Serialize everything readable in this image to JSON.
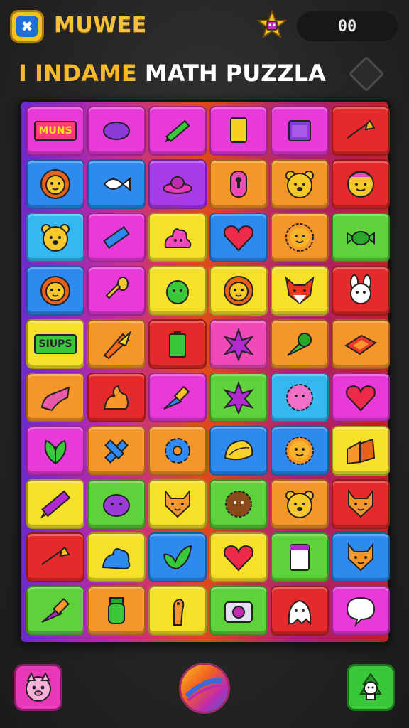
{
  "header": {
    "app_title": "MUWEE",
    "logo_glyph": "✖",
    "score": "00"
  },
  "title": {
    "part1": "I INDAME",
    "part2": "MATH PUZZLA"
  },
  "colors": {
    "purple": "#a93ce8",
    "magenta": "#e83ad8",
    "pink": "#f04ab8",
    "red": "#e42a2a",
    "orange": "#f5962a",
    "yellow": "#f7e02a",
    "green": "#5ed23a",
    "blue": "#2f8af0",
    "cyan": "#35b8f0"
  },
  "board": {
    "rows": [
      [
        {
          "color": "magenta",
          "icon": "text-label-icon",
          "label": "MUNS"
        },
        {
          "color": "magenta",
          "icon": "purple-bean-icon"
        },
        {
          "color": "magenta",
          "icon": "pencil-icon"
        },
        {
          "color": "magenta",
          "icon": "yellow-card-icon"
        },
        {
          "color": "magenta",
          "icon": "box-icon"
        },
        {
          "color": "red",
          "icon": "arrow-icon"
        }
      ],
      [
        {
          "color": "blue",
          "icon": "lion-face-icon"
        },
        {
          "color": "blue",
          "icon": "fish-icon"
        },
        {
          "color": "purple",
          "icon": "saucer-icon"
        },
        {
          "color": "orange",
          "icon": "keyhole-icon"
        },
        {
          "color": "orange",
          "icon": "bear-face-icon"
        },
        {
          "color": "red",
          "icon": "monkey-face-icon"
        }
      ],
      [
        {
          "color": "cyan",
          "icon": "bear-face-icon"
        },
        {
          "color": "magenta",
          "icon": "marker-icon"
        },
        {
          "color": "yellow",
          "icon": "blob-icon"
        },
        {
          "color": "blue",
          "icon": "heart-icon"
        },
        {
          "color": "orange",
          "icon": "sun-face-icon"
        },
        {
          "color": "green",
          "icon": "candy-icon"
        }
      ],
      [
        {
          "color": "blue",
          "icon": "lion-face-icon"
        },
        {
          "color": "magenta",
          "icon": "spoon-icon"
        },
        {
          "color": "yellow",
          "icon": "green-blob-icon"
        },
        {
          "color": "yellow",
          "icon": "lion-face-icon"
        },
        {
          "color": "yellow",
          "icon": "fox-face-icon"
        },
        {
          "color": "red",
          "icon": "bunny-face-icon"
        }
      ],
      [
        {
          "color": "yellow",
          "icon": "text-label-icon",
          "label": "SIUPS"
        },
        {
          "color": "orange",
          "icon": "rocket-icon"
        },
        {
          "color": "red",
          "icon": "battery-icon"
        },
        {
          "color": "pink",
          "icon": "star-burst-icon"
        },
        {
          "color": "orange",
          "icon": "pin-icon"
        },
        {
          "color": "orange",
          "icon": "diamond-icon"
        }
      ],
      [
        {
          "color": "orange",
          "icon": "boot-icon"
        },
        {
          "color": "red",
          "icon": "swirl-icon"
        },
        {
          "color": "magenta",
          "icon": "paintbrush-icon"
        },
        {
          "color": "green",
          "icon": "star-burst-icon"
        },
        {
          "color": "cyan",
          "icon": "flower-face-icon"
        },
        {
          "color": "magenta",
          "icon": "heart-icon"
        }
      ],
      [
        {
          "color": "magenta",
          "icon": "leaf-icon"
        },
        {
          "color": "orange",
          "icon": "cross-icon"
        },
        {
          "color": "orange",
          "icon": "gear-icon"
        },
        {
          "color": "blue",
          "icon": "shell-icon"
        },
        {
          "color": "blue",
          "icon": "sun-face-icon"
        },
        {
          "color": "yellow",
          "icon": "blocks-icon"
        }
      ],
      [
        {
          "color": "yellow",
          "icon": "crayon-icon"
        },
        {
          "color": "green",
          "icon": "purple-blob-icon"
        },
        {
          "color": "yellow",
          "icon": "cat-face-icon"
        },
        {
          "color": "green",
          "icon": "hedgehog-icon"
        },
        {
          "color": "orange",
          "icon": "bear-face-icon"
        },
        {
          "color": "red",
          "icon": "cat-face-icon"
        }
      ],
      [
        {
          "color": "red",
          "icon": "arrow-icon"
        },
        {
          "color": "yellow",
          "icon": "blue-blob-icon"
        },
        {
          "color": "blue",
          "icon": "bird-icon"
        },
        {
          "color": "yellow",
          "icon": "heart-icon"
        },
        {
          "color": "green",
          "icon": "card-icon"
        },
        {
          "color": "blue",
          "icon": "cat-face-icon"
        }
      ],
      [
        {
          "color": "green",
          "icon": "spray-icon"
        },
        {
          "color": "orange",
          "icon": "jar-icon"
        },
        {
          "color": "yellow",
          "icon": "giraffe-icon"
        },
        {
          "color": "green",
          "icon": "camera-icon"
        },
        {
          "color": "red",
          "icon": "ghost-icon"
        },
        {
          "color": "magenta",
          "icon": "speech-bubble-icon"
        }
      ]
    ]
  },
  "bottom": {
    "left_icon": "pig-face-icon",
    "center_icon": "spin-ball-icon",
    "right_icon": "character-icon"
  }
}
